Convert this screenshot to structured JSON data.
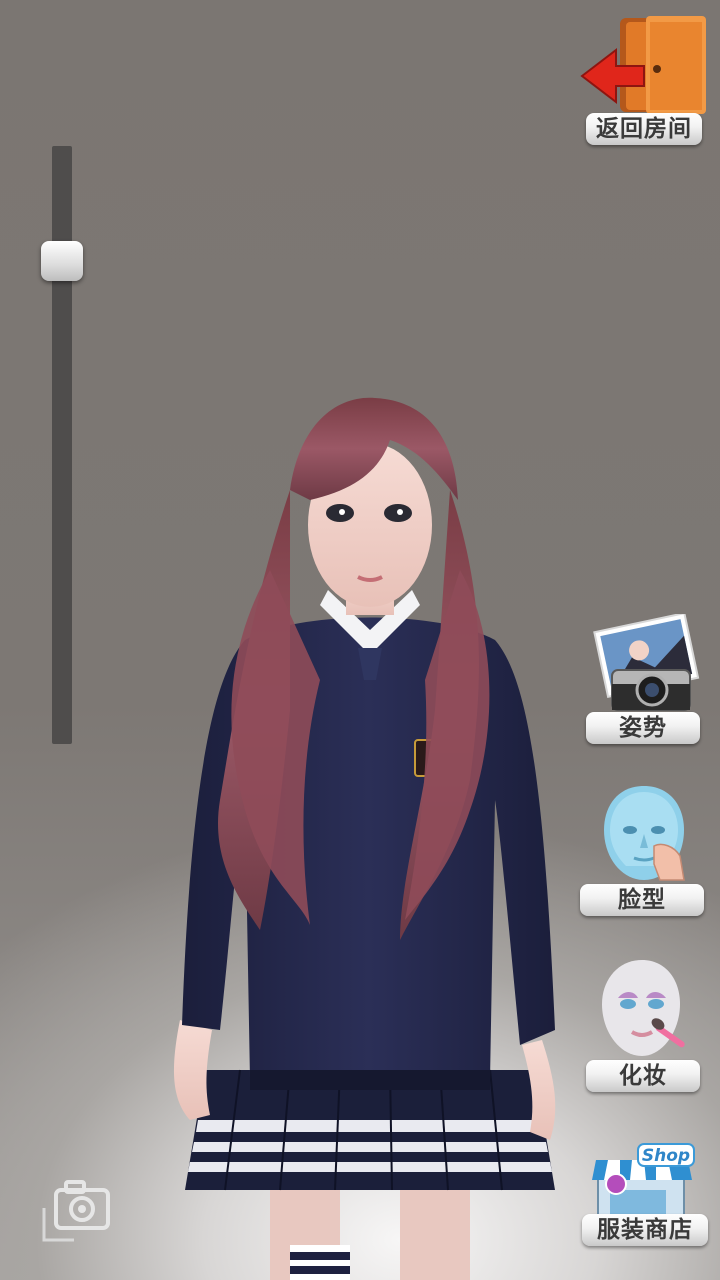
{
  "top_right": {
    "exit_label": "返回房间",
    "exit_icon": "door-exit-arrow-icon"
  },
  "zoom_slider": {
    "value": 0.17
  },
  "side_menu": {
    "pose_label": "姿势",
    "face_label": "脸型",
    "makeup_label": "化妆",
    "shop_label": "服装商店",
    "shop_sign": "Shop"
  },
  "bottom_left": {
    "camera_icon": "camera-icon"
  },
  "colors": {
    "background": "#7b7672",
    "slider_track": "#4f4d4c",
    "exit_arrow": "#e0261b",
    "door": "#e17a28",
    "sweater": "#23274a",
    "hair": "#8a4a55"
  }
}
